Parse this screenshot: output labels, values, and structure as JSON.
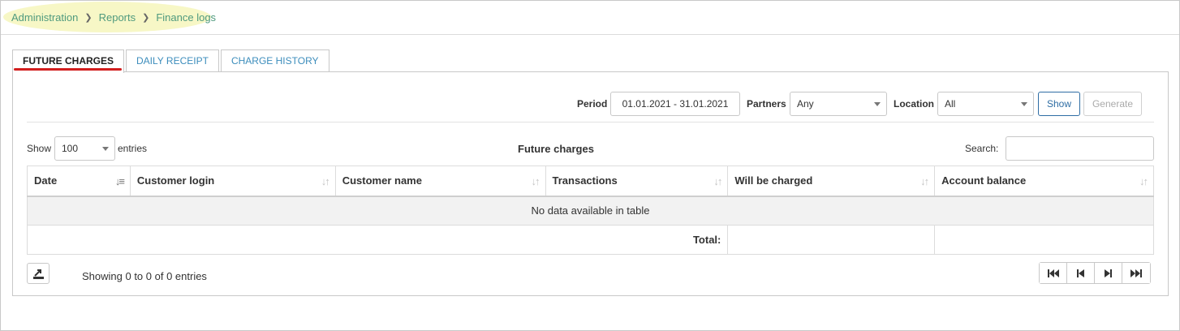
{
  "breadcrumb": {
    "items": [
      "Administration",
      "Reports",
      "Finance logs"
    ]
  },
  "tabs": [
    {
      "label": "FUTURE CHARGES",
      "active": true
    },
    {
      "label": "DAILY RECEIPT",
      "active": false
    },
    {
      "label": "CHARGE HISTORY",
      "active": false
    }
  ],
  "filters": {
    "period_label": "Period",
    "period_value": "01.01.2021 - 31.01.2021",
    "partners_label": "Partners",
    "partners_value": "Any",
    "location_label": "Location",
    "location_value": "All",
    "show_label": "Show",
    "generate_label": "Generate"
  },
  "controls": {
    "show_label": "Show",
    "entries_value": "100",
    "entries_label": "entries",
    "table_title": "Future charges",
    "search_label": "Search:"
  },
  "table": {
    "columns": [
      "Date",
      "Customer login",
      "Customer name",
      "Transactions",
      "Will be charged",
      "Account balance"
    ],
    "empty_message": "No data available in table",
    "total_label": "Total:"
  },
  "footer": {
    "info": "Showing 0 to 0 of 0 entries"
  },
  "colors": {
    "link": "#4f9a7e",
    "tab_link": "#3c8dbc",
    "active_underline": "#d21e1e",
    "primary_button": "#2e6da4"
  }
}
